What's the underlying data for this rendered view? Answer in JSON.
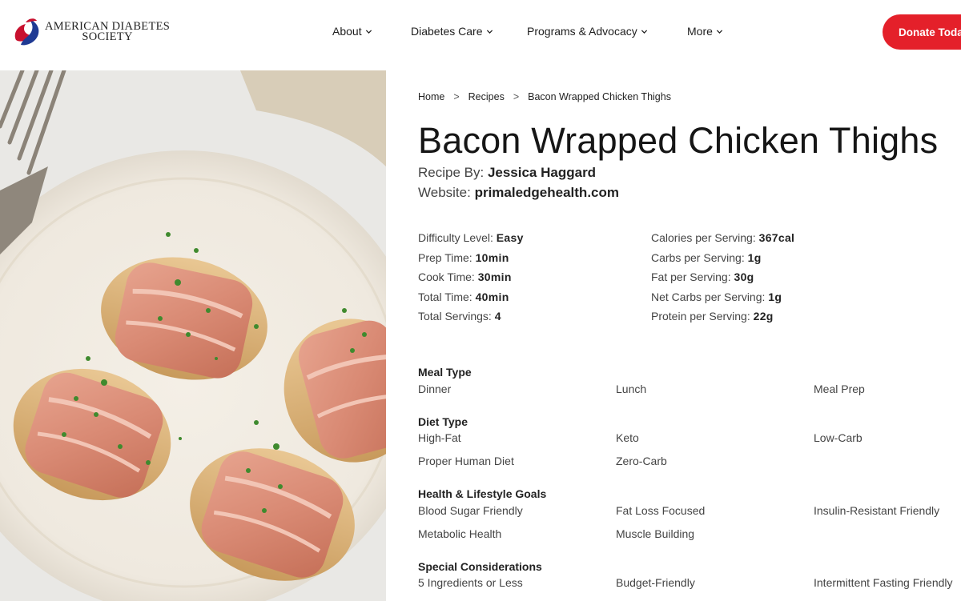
{
  "header": {
    "logo_line1": "AMERICAN DIABETES",
    "logo_line2": "SOCIETY",
    "nav": [
      "About",
      "Diabetes Care",
      "Programs & Advocacy",
      "More"
    ],
    "donate_label": "Donate Today",
    "brand_color": "#e4202a"
  },
  "breadcrumb": [
    "Home",
    "Recipes",
    "Bacon Wrapped Chicken Thighs"
  ],
  "recipe": {
    "title": "Bacon Wrapped Chicken Thighs",
    "author_label": "Recipe By: ",
    "author": "Jessica Haggard",
    "website_label": "Website: ",
    "website": "primaledgehealth.com"
  },
  "stats_left": [
    {
      "label": "Difficulty Level: ",
      "value": "Easy"
    },
    {
      "label": "Prep Time: ",
      "value": "10min"
    },
    {
      "label": "Cook Time: ",
      "value": "30min"
    },
    {
      "label": "Total Time: ",
      "value": "40min"
    },
    {
      "label": "Total Servings: ",
      "value": "4"
    }
  ],
  "stats_right": [
    {
      "label": "Calories per Serving: ",
      "value": "367cal"
    },
    {
      "label": "Carbs per Serving: ",
      "value": "1g"
    },
    {
      "label": "Fat per Serving: ",
      "value": "30g"
    },
    {
      "label": "Net Carbs per Serving: ",
      "value": "1g"
    },
    {
      "label": "Protein per Serving: ",
      "value": "22g"
    }
  ],
  "groups": [
    {
      "title": "Meal Type",
      "tags": [
        "Dinner",
        "Lunch",
        "Meal Prep"
      ]
    },
    {
      "title": "Diet Type",
      "tags": [
        "High-Fat",
        "Keto",
        "Low-Carb",
        "Proper Human Diet",
        "Zero-Carb"
      ]
    },
    {
      "title": "Health & Lifestyle Goals",
      "tags": [
        "Blood Sugar Friendly",
        "Fat Loss Focused",
        "Insulin-Resistant Friendly",
        "Metabolic Health",
        "Muscle Building"
      ]
    },
    {
      "title": "Special Considerations",
      "tags": [
        "5 Ingredients or Less",
        "Budget-Friendly",
        "Intermittent Fasting Friendly"
      ]
    }
  ]
}
